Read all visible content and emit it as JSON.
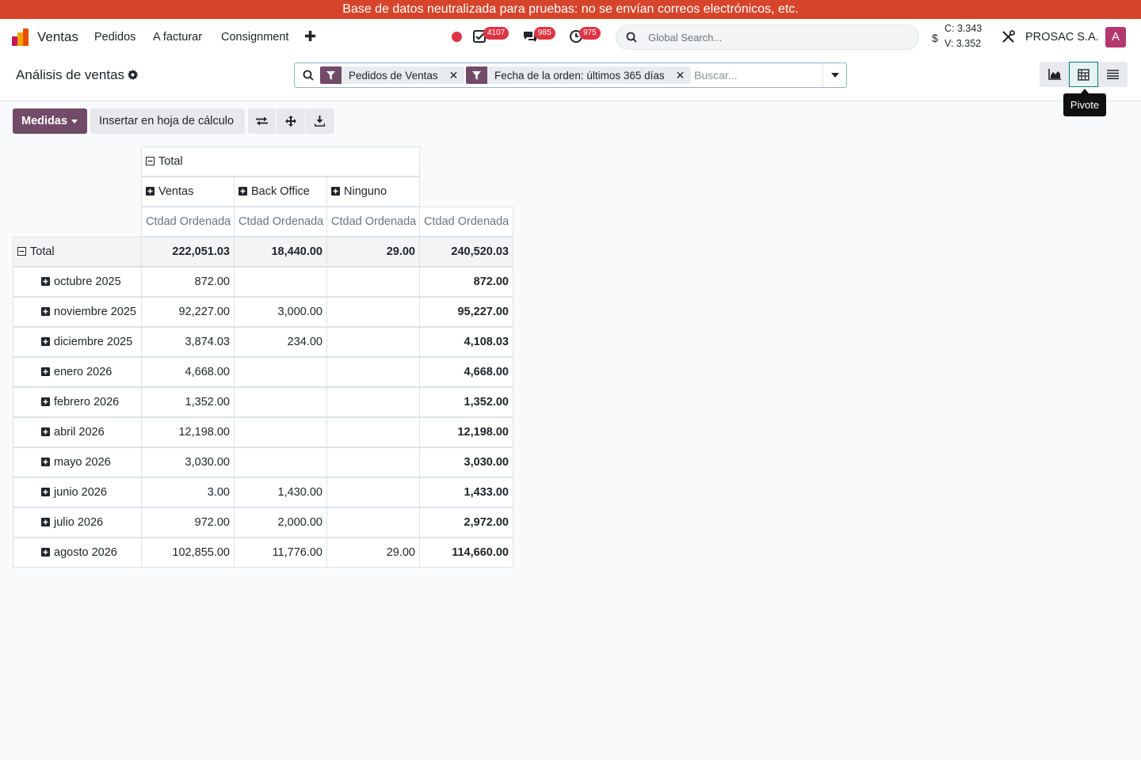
{
  "banner": "Base de datos neutralizada para pruebas: no se envían correos electrónicos, etc.",
  "navbar": {
    "app_name": "Ventas",
    "menu": [
      "Pedidos",
      "A facturar",
      "Consignment"
    ],
    "badges": {
      "activities": "4107",
      "messages": "985",
      "clock": "975"
    },
    "global_search_placeholder": "Global Search...",
    "rate_c": "C: 3.343",
    "rate_v": "V: 3.352",
    "rate_symbol": "$",
    "company": "PROSAC S.A.",
    "avatar_letter": "A"
  },
  "control_panel": {
    "title": "Análisis de ventas",
    "facets": [
      "Pedidos de Ventas",
      "Fecha de la orden: últimos 365 días"
    ],
    "search_placeholder": "Buscar...",
    "tooltip": "Pivote"
  },
  "toolbar": {
    "measures_label": "Medidas",
    "insert_label": "Insertar en hoja de cálculo"
  },
  "pivot": {
    "col_total": "Total",
    "col_groups": [
      "Ventas",
      "Back Office",
      "Ninguno"
    ],
    "measure": "Ctdad Ordenada",
    "row_total_label": "Total",
    "total_values": [
      "222,051.03",
      "18,440.00",
      "29.00",
      "240,520.03"
    ],
    "rows": [
      {
        "label": "octubre 2025",
        "values": [
          "872.00",
          "",
          "",
          "872.00"
        ]
      },
      {
        "label": "noviembre 2025",
        "values": [
          "92,227.00",
          "3,000.00",
          "",
          "95,227.00"
        ]
      },
      {
        "label": "diciembre 2025",
        "values": [
          "3,874.03",
          "234.00",
          "",
          "4,108.03"
        ]
      },
      {
        "label": "enero 2026",
        "values": [
          "4,668.00",
          "",
          "",
          "4,668.00"
        ]
      },
      {
        "label": "febrero 2026",
        "values": [
          "1,352.00",
          "",
          "",
          "1,352.00"
        ]
      },
      {
        "label": "abril 2026",
        "values": [
          "12,198.00",
          "",
          "",
          "12,198.00"
        ]
      },
      {
        "label": "mayo 2026",
        "values": [
          "3,030.00",
          "",
          "",
          "3,030.00"
        ]
      },
      {
        "label": "junio 2026",
        "values": [
          "3.00",
          "1,430.00",
          "",
          "1,433.00"
        ]
      },
      {
        "label": "julio 2026",
        "values": [
          "972.00",
          "2,000.00",
          "",
          "2,972.00"
        ]
      },
      {
        "label": "agosto 2026",
        "values": [
          "102,855.00",
          "11,776.00",
          "29.00",
          "114,660.00"
        ]
      }
    ]
  }
}
